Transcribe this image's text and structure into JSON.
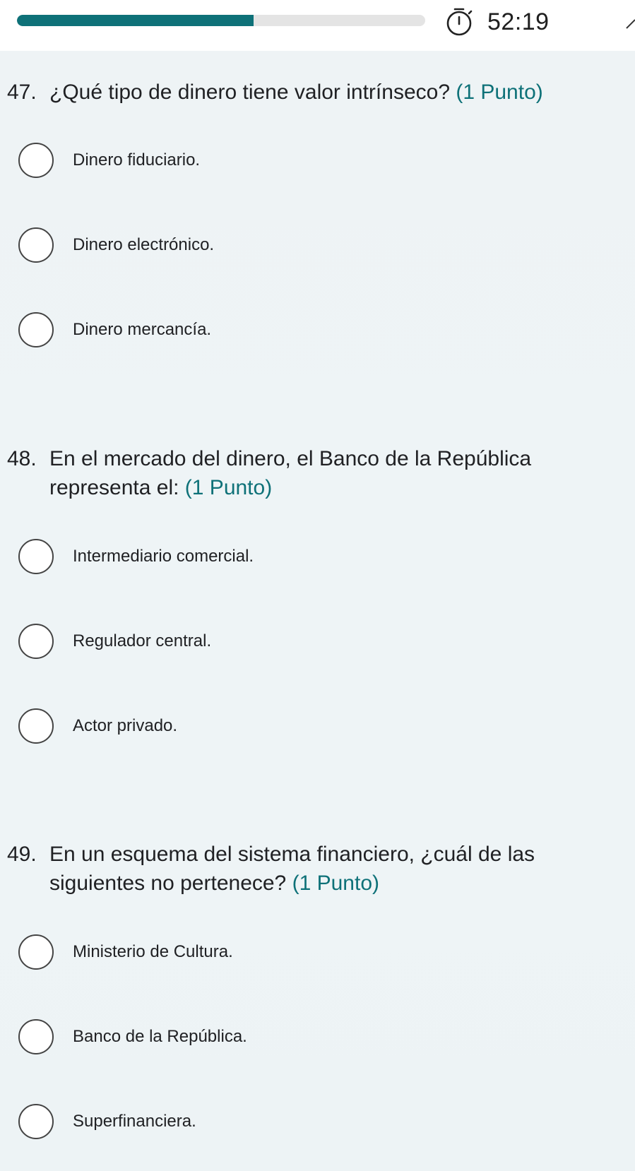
{
  "header": {
    "progress": 0.58,
    "timer": "52:19",
    "timer_icon": "stopwatch-icon"
  },
  "questions": [
    {
      "number": "47.",
      "text": "¿Qué tipo de dinero tiene valor intrínseco?",
      "points": "(1 Punto)",
      "options": [
        "Dinero fiduciario.",
        "Dinero electrónico.",
        "Dinero mercancía."
      ]
    },
    {
      "number": "48.",
      "text": "En el mercado del dinero, el Banco de la República representa el:",
      "points": "(1 Punto)",
      "options": [
        "Intermediario comercial.",
        "Regulador central.",
        "Actor privado."
      ]
    },
    {
      "number": "49.",
      "text": "En un esquema del sistema financiero, ¿cuál de las siguientes no pertenece?",
      "points": "(1 Punto)",
      "options": [
        "Ministerio de Cultura.",
        "Banco de la República.",
        "Superfinanciera."
      ]
    }
  ],
  "colors": {
    "accent": "#0e7178",
    "track": "#e4e4e4",
    "background": "#eef3f5"
  }
}
